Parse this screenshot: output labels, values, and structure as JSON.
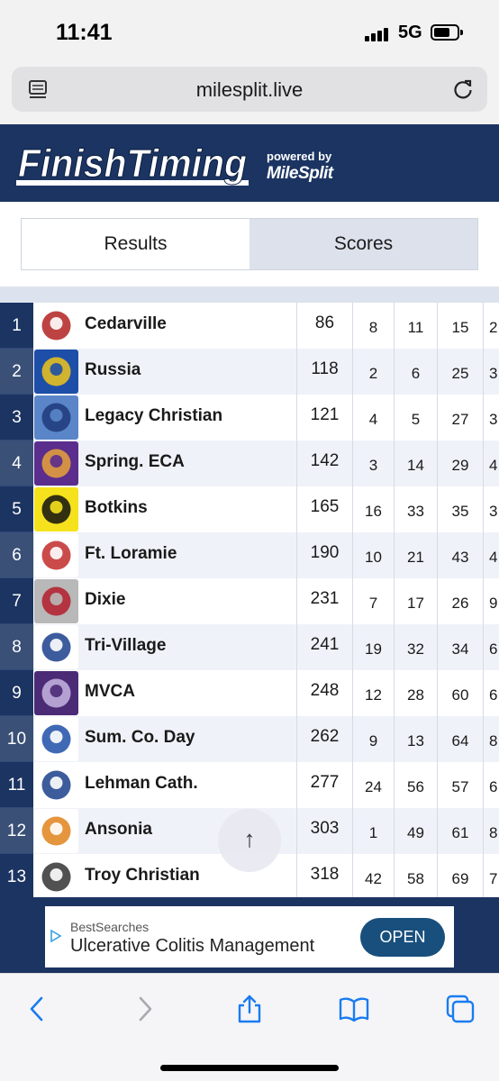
{
  "status_bar": {
    "time": "11:41",
    "network": "5G"
  },
  "browser": {
    "url": "milesplit.live"
  },
  "banner": {
    "logo_text": "FinishTiming",
    "powered_by": "powered by",
    "partner": "MileSplit"
  },
  "tabs": [
    {
      "label": "Results",
      "active": false
    },
    {
      "label": "Scores",
      "active": true
    }
  ],
  "teams": [
    {
      "rank": "1",
      "name": "Cedarville",
      "score": "86",
      "p1": "8",
      "p2": "11",
      "p3": "15",
      "p4": "2",
      "logo": "cedarville-logo"
    },
    {
      "rank": "2",
      "name": "Russia",
      "score": "118",
      "p1": "2",
      "p2": "6",
      "p3": "25",
      "p4": "3",
      "logo": "russia-logo"
    },
    {
      "rank": "3",
      "name": "Legacy Christian",
      "score": "121",
      "p1": "4",
      "p2": "5",
      "p3": "27",
      "p4": "3",
      "logo": "legacy-christian-logo"
    },
    {
      "rank": "4",
      "name": "Spring. ECA",
      "score": "142",
      "p1": "3",
      "p2": "14",
      "p3": "29",
      "p4": "4",
      "logo": "spring-eca-logo"
    },
    {
      "rank": "5",
      "name": "Botkins",
      "score": "165",
      "p1": "16",
      "p2": "33",
      "p3": "35",
      "p4": "3",
      "logo": "botkins-logo"
    },
    {
      "rank": "6",
      "name": "Ft. Loramie",
      "score": "190",
      "p1": "10",
      "p2": "21",
      "p3": "43",
      "p4": "4",
      "logo": "ft-loramie-logo"
    },
    {
      "rank": "7",
      "name": "Dixie",
      "score": "231",
      "p1": "7",
      "p2": "17",
      "p3": "26",
      "p4": "9",
      "logo": "dixie-logo"
    },
    {
      "rank": "8",
      "name": "Tri-Village",
      "score": "241",
      "p1": "19",
      "p2": "32",
      "p3": "34",
      "p4": "6",
      "logo": "tri-village-logo"
    },
    {
      "rank": "9",
      "name": "MVCA",
      "score": "248",
      "p1": "12",
      "p2": "28",
      "p3": "60",
      "p4": "6",
      "logo": "mvca-logo"
    },
    {
      "rank": "10",
      "name": "Sum. Co. Day",
      "score": "262",
      "p1": "9",
      "p2": "13",
      "p3": "64",
      "p4": "8",
      "logo": "summit-logo"
    },
    {
      "rank": "11",
      "name": "Lehman Cath.",
      "score": "277",
      "p1": "24",
      "p2": "56",
      "p3": "57",
      "p4": "6",
      "logo": "lehman-logo"
    },
    {
      "rank": "12",
      "name": "Ansonia",
      "score": "303",
      "p1": "1",
      "p2": "49",
      "p3": "61",
      "p4": "8",
      "logo": "ansonia-logo"
    },
    {
      "rank": "13",
      "name": "Troy Christian",
      "score": "318",
      "p1": "42",
      "p2": "58",
      "p3": "69",
      "p4": "7",
      "logo": "troy-christian-logo"
    }
  ],
  "ad": {
    "source": "BestSearches",
    "title": "Ulcerative Colitis Management",
    "button": "OPEN"
  },
  "toolbar": {
    "icons": [
      "back-icon",
      "forward-icon",
      "share-icon",
      "bookmarks-icon",
      "tabs-icon"
    ]
  },
  "colors": {
    "navy": "#1b3462",
    "tab_active": "#dde1ec",
    "ad_button": "#184f7d"
  }
}
